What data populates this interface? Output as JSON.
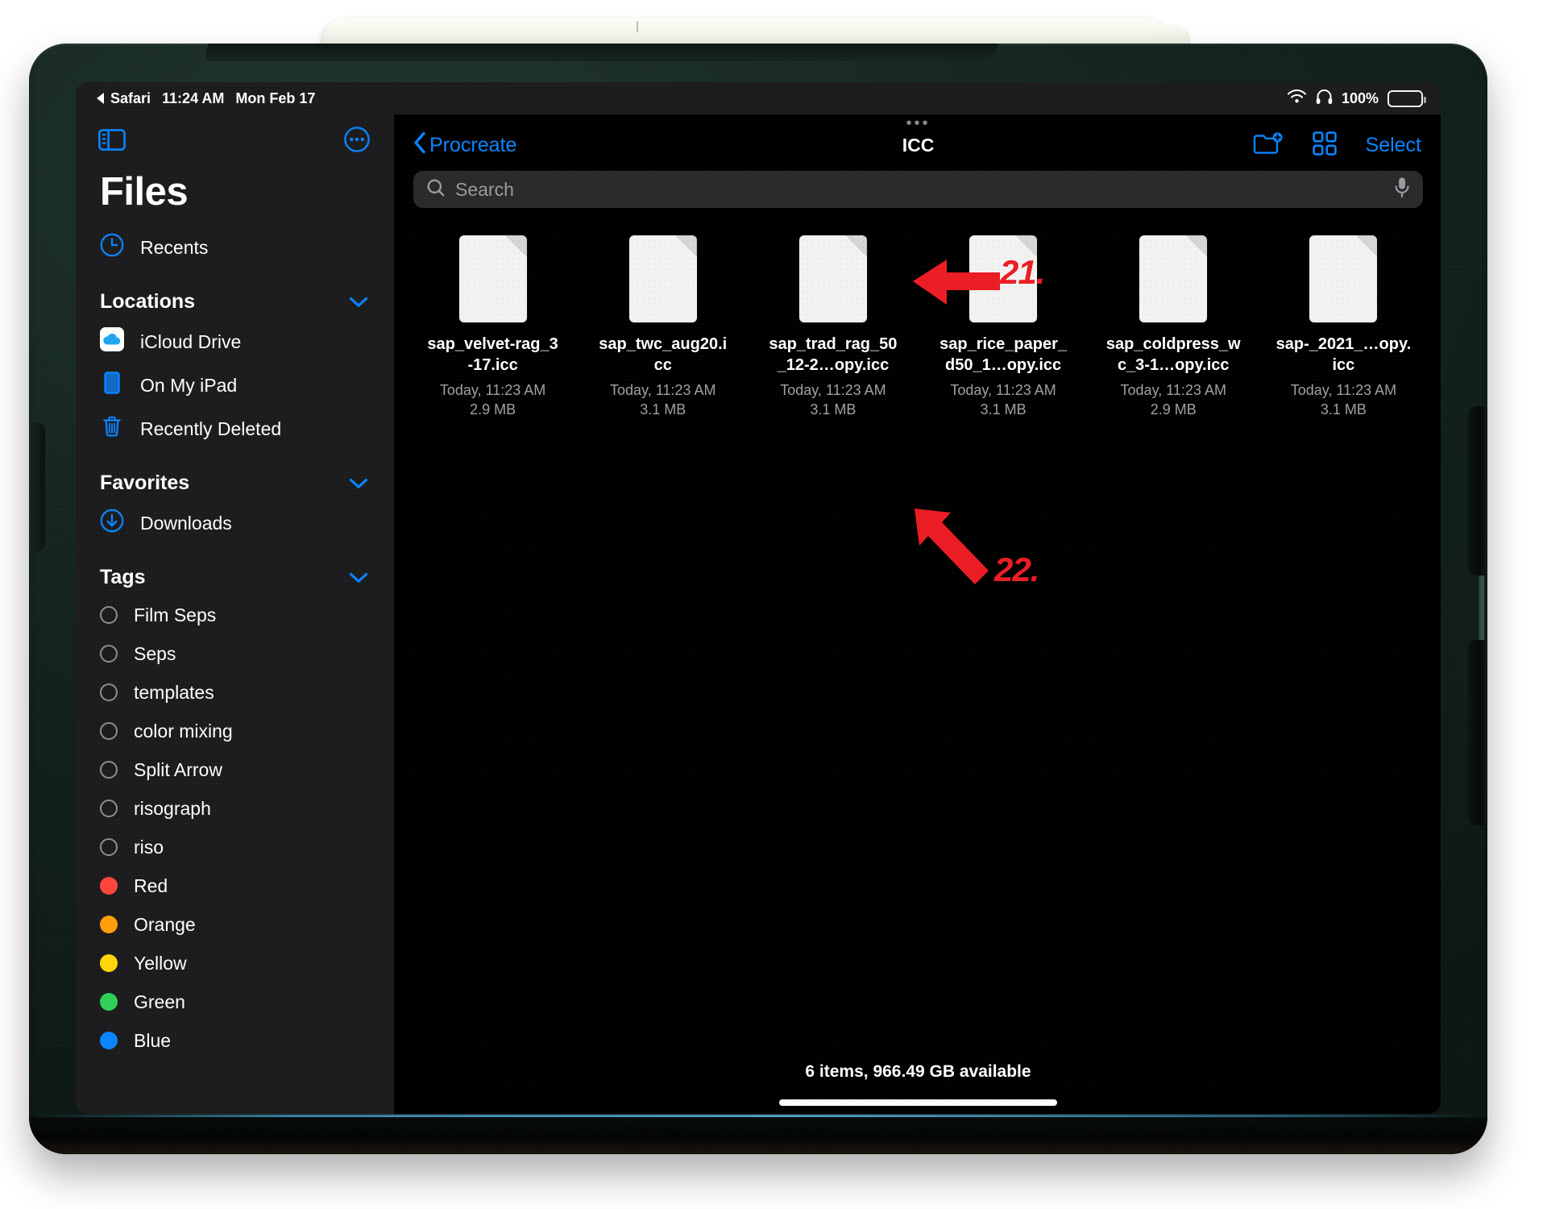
{
  "status_bar": {
    "back_app": "Safari",
    "time": "11:24 AM",
    "date": "Mon Feb 17",
    "wifi_icon": "wifi-icon",
    "headphones_icon": "headphones-icon",
    "battery_percent": "100%"
  },
  "sidebar": {
    "sidebar_toggle_icon": "sidebar-toggle-icon",
    "more_icon": "more-ellipsis-icon",
    "title": "Files",
    "recents": {
      "label": "Recents",
      "icon": "clock-icon"
    },
    "sections": [
      {
        "title": "Locations",
        "chevron": "chevron-down-icon",
        "items": [
          {
            "label": "iCloud Drive",
            "icon": "icloud-drive-icon"
          },
          {
            "label": "On My iPad",
            "icon": "ipad-icon"
          },
          {
            "label": "Recently Deleted",
            "icon": "trash-icon"
          }
        ]
      },
      {
        "title": "Favorites",
        "chevron": "chevron-down-icon",
        "items": [
          {
            "label": "Downloads",
            "icon": "download-circle-icon"
          }
        ]
      },
      {
        "title": "Tags",
        "chevron": "chevron-down-icon",
        "items": [
          {
            "label": "Film Seps",
            "icon": "tag-dot-icon",
            "color": "none"
          },
          {
            "label": "Seps",
            "icon": "tag-dot-icon",
            "color": "none"
          },
          {
            "label": "templates",
            "icon": "tag-dot-icon",
            "color": "none"
          },
          {
            "label": "color mixing",
            "icon": "tag-dot-icon",
            "color": "none"
          },
          {
            "label": "Split Arrow",
            "icon": "tag-dot-icon",
            "color": "none"
          },
          {
            "label": "risograph",
            "icon": "tag-dot-icon",
            "color": "none"
          },
          {
            "label": "riso",
            "icon": "tag-dot-icon",
            "color": "none"
          },
          {
            "label": "Red",
            "icon": "tag-dot-icon",
            "color": "#ff453a"
          },
          {
            "label": "Orange",
            "icon": "tag-dot-icon",
            "color": "#ff9f0a"
          },
          {
            "label": "Yellow",
            "icon": "tag-dot-icon",
            "color": "#ffd60a"
          },
          {
            "label": "Green",
            "icon": "tag-dot-icon",
            "color": "#30d158"
          },
          {
            "label": "Blue",
            "icon": "tag-dot-icon",
            "color": "#0a84ff"
          }
        ]
      }
    ]
  },
  "navbar": {
    "back_label": "Procreate",
    "back_icon": "chevron-left-icon",
    "title": "ICC",
    "new_folder_icon": "new-folder-icon",
    "grid_view_icon": "grid-view-icon",
    "select_label": "Select"
  },
  "search": {
    "placeholder": "Search",
    "value": "",
    "search_icon": "search-icon",
    "mic_icon": "microphone-icon"
  },
  "files": [
    {
      "name": "sap_velvet-rag_3-17.icc",
      "date": "Today, 11:23 AM",
      "size": "2.9 MB",
      "icon": "document-icon"
    },
    {
      "name": "sap_twc_aug20.icc",
      "date": "Today, 11:23 AM",
      "size": "3.1 MB",
      "icon": "document-icon"
    },
    {
      "name": "sap_trad_rag_50_12-2…opy.icc",
      "date": "Today, 11:23 AM",
      "size": "3.1 MB",
      "icon": "document-icon"
    },
    {
      "name": "sap_rice_paper_d50_1…opy.icc",
      "date": "Today, 11:23 AM",
      "size": "3.1 MB",
      "icon": "document-icon"
    },
    {
      "name": "sap_coldpress_wc_3-1…opy.icc",
      "date": "Today, 11:23 AM",
      "size": "2.9 MB",
      "icon": "document-icon"
    },
    {
      "name": "sap-_2021_…opy.icc",
      "date": "Today, 11:23 AM",
      "size": "3.1 MB",
      "icon": "document-icon"
    }
  ],
  "footer": {
    "status": "6 items, 966.49 GB available"
  },
  "annotations": {
    "accent_color": "#ec1c24",
    "markers": [
      {
        "label": "21.",
        "points_at": "Procreate back button",
        "icon": "arrow-left-icon"
      },
      {
        "label": "22.",
        "points_at": "file size of sap_velvet-rag_3-17.icc",
        "icon": "arrow-up-left-icon"
      }
    ]
  }
}
